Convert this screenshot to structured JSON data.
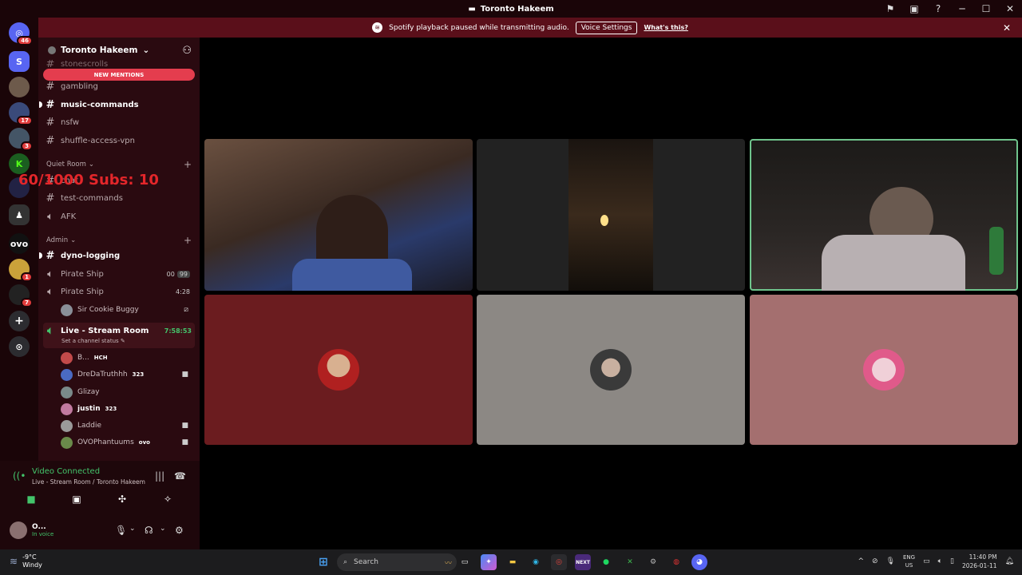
{
  "window": {
    "title": "Toronto Hakeem"
  },
  "banner": {
    "message": "Spotify playback paused while transmitting audio.",
    "voice_settings": "Voice Settings",
    "whats_this": "What's this?"
  },
  "guild_badges": {
    "top": "46",
    "g4": "17",
    "g5": "3",
    "g10": "1",
    "g11": "7"
  },
  "server": {
    "name": "Toronto Hakeem",
    "new_mentions": "NEW MENTIONS",
    "clipped_channel": "stonescrolls",
    "channels_top": [
      "gambling",
      "music-commands",
      "nsfw",
      "shuffle-access-vpn"
    ],
    "quiet_room": "Quiet Room",
    "quiet_channel": "chat",
    "test_channel": "test-commands",
    "afk_channel": "AFK",
    "admin": "Admin",
    "dyno": "dyno-logging",
    "pirate1": {
      "name": "Pirate Ship",
      "left": "00",
      "right": "99"
    },
    "pirate2": {
      "name": "Pirate Ship",
      "time": "4:28"
    },
    "pirate2_member": "Sir Cookie Buggy",
    "live_room": {
      "name": "Live - Stream Room",
      "time": "7:58:53",
      "status": "Set a channel status"
    },
    "live_members": [
      {
        "name": "B...",
        "badge": "HCH"
      },
      {
        "name": "DreDaTruthhh",
        "badge": "323"
      },
      {
        "name": "Glizay",
        "badge": ""
      },
      {
        "name": "justin",
        "badge": "323"
      },
      {
        "name": "Laddie",
        "badge": ""
      },
      {
        "name": "OVOPhantuums",
        "badge": "ovo"
      }
    ]
  },
  "overlay": {
    "text": "60/1000  Subs: 10"
  },
  "voice": {
    "status": "Video Connected",
    "location": "Live - Stream Room / Toronto Hakeem",
    "user_name": "O...",
    "user_status": "In voice"
  },
  "taskbar": {
    "weather_temp": "-9°C",
    "weather_desc": "Windy",
    "search": "Search",
    "lang": "ENG",
    "region": "US",
    "time": "11:40 PM",
    "date": "2026-01-11"
  },
  "colors": {
    "tile_red": "#6b1c1f",
    "tile_gray": "#8c8884",
    "tile_pink": "#a46f6f",
    "speaking_outline": "#6fc48c",
    "accent_red": "#e43d4e"
  }
}
